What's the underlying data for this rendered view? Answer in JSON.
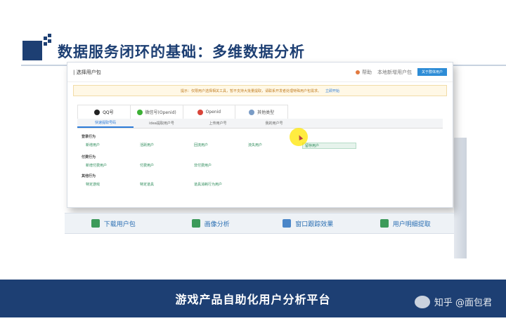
{
  "slide": {
    "title": "数据服务闭环的基础：多维数据分析",
    "footer_title": "游戏产品自助化用户分析平台",
    "watermark": "知乎 @面包君"
  },
  "app": {
    "section_title": "| 选择用户包",
    "top_links": [
      "帮助",
      "本地新增用户包"
    ],
    "primary_button": "关于群体用户",
    "notice_text": "提示：仅限用户选择相关工具，暂不支持大批量提取，请联系开发者处理特殊用户包需求。",
    "notice_link": "立即开始",
    "tabs": [
      {
        "label": "QQ号",
        "icon_color": "#222222"
      },
      {
        "label": "微信号(Openid)",
        "icon_color": "#3cb035"
      },
      {
        "label": "Openid",
        "icon_color": "#d9453a"
      },
      {
        "label": "其他类型",
        "icon_color": "#7a9cc6"
      }
    ],
    "subtabs": [
      "快速提取号码",
      "idea提取用户号",
      "上传用户号",
      "我的用户号"
    ],
    "groups": [
      {
        "label": "登录行为",
        "items": [
          "新增用户",
          "活跃用户",
          "回流用户",
          "流失用户",
          "留存用户"
        ]
      },
      {
        "label": "付费行为",
        "items": [
          "新增付费用户",
          "付费用户",
          "非付费用户"
        ]
      },
      {
        "label": "其他行为",
        "items": [
          "特定游戏",
          "特定道具",
          "道具消耗行为用户"
        ]
      }
    ]
  },
  "toolbar": {
    "items": [
      {
        "label": "下载用户包",
        "icon_color": "#3c9a5a"
      },
      {
        "label": "画像分析",
        "icon_color": "#3c9a5a"
      },
      {
        "label": "窗口跟踪效果",
        "icon_color": "#4a86c8"
      },
      {
        "label": "用户明细提取",
        "icon_color": "#3c9a5a"
      }
    ]
  },
  "colors": {
    "brand": "#1d3f73",
    "accent": "#2d8cd6",
    "highlight": "#ffe600"
  }
}
